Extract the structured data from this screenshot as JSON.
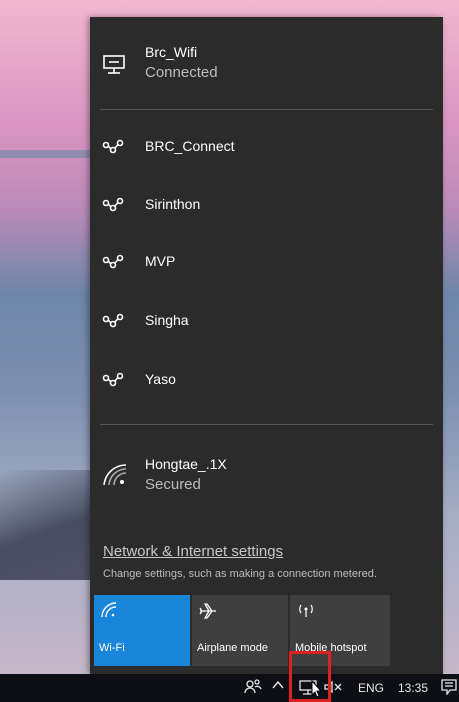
{
  "network_flyout": {
    "connected": {
      "name": "Brc_Wifi",
      "status": "Connected",
      "icon": "ethernet-icon"
    },
    "networks": [
      {
        "name": "BRC_Connect",
        "icon": "dialup-icon"
      },
      {
        "name": "Sirinthon",
        "icon": "dialup-icon"
      },
      {
        "name": "MVP",
        "icon": "dialup-icon"
      },
      {
        "name": "Singha",
        "icon": "dialup-icon"
      },
      {
        "name": "Yaso",
        "icon": "dialup-icon"
      }
    ],
    "wifi_network": {
      "name": "Hongtae_.1X",
      "status": "Secured",
      "icon": "wifi-signal-icon"
    },
    "settings_link": "Network & Internet settings",
    "settings_desc": "Change settings, such as making a connection metered.",
    "quick_actions": [
      {
        "label": "Wi-Fi",
        "icon": "wifi-icon",
        "active": true
      },
      {
        "label": "Airplane mode",
        "icon": "airplane-icon",
        "active": false
      },
      {
        "label": "Mobile hotspot",
        "icon": "hotspot-icon",
        "active": false
      }
    ]
  },
  "taskbar": {
    "people_icon": "people-icon",
    "chevron_icon": "chevron-up-icon",
    "network_icon": "ethernet-icon",
    "volume_icon": "volume-muted-icon",
    "language": "ENG",
    "time": "13:35",
    "notification_icon": "action-center-icon"
  },
  "colors": {
    "panel": "#2b2b2b",
    "accent": "#1a86d9",
    "tile": "#3f3f3f",
    "taskbar": "#0d0f14",
    "highlight": "#e02020"
  }
}
